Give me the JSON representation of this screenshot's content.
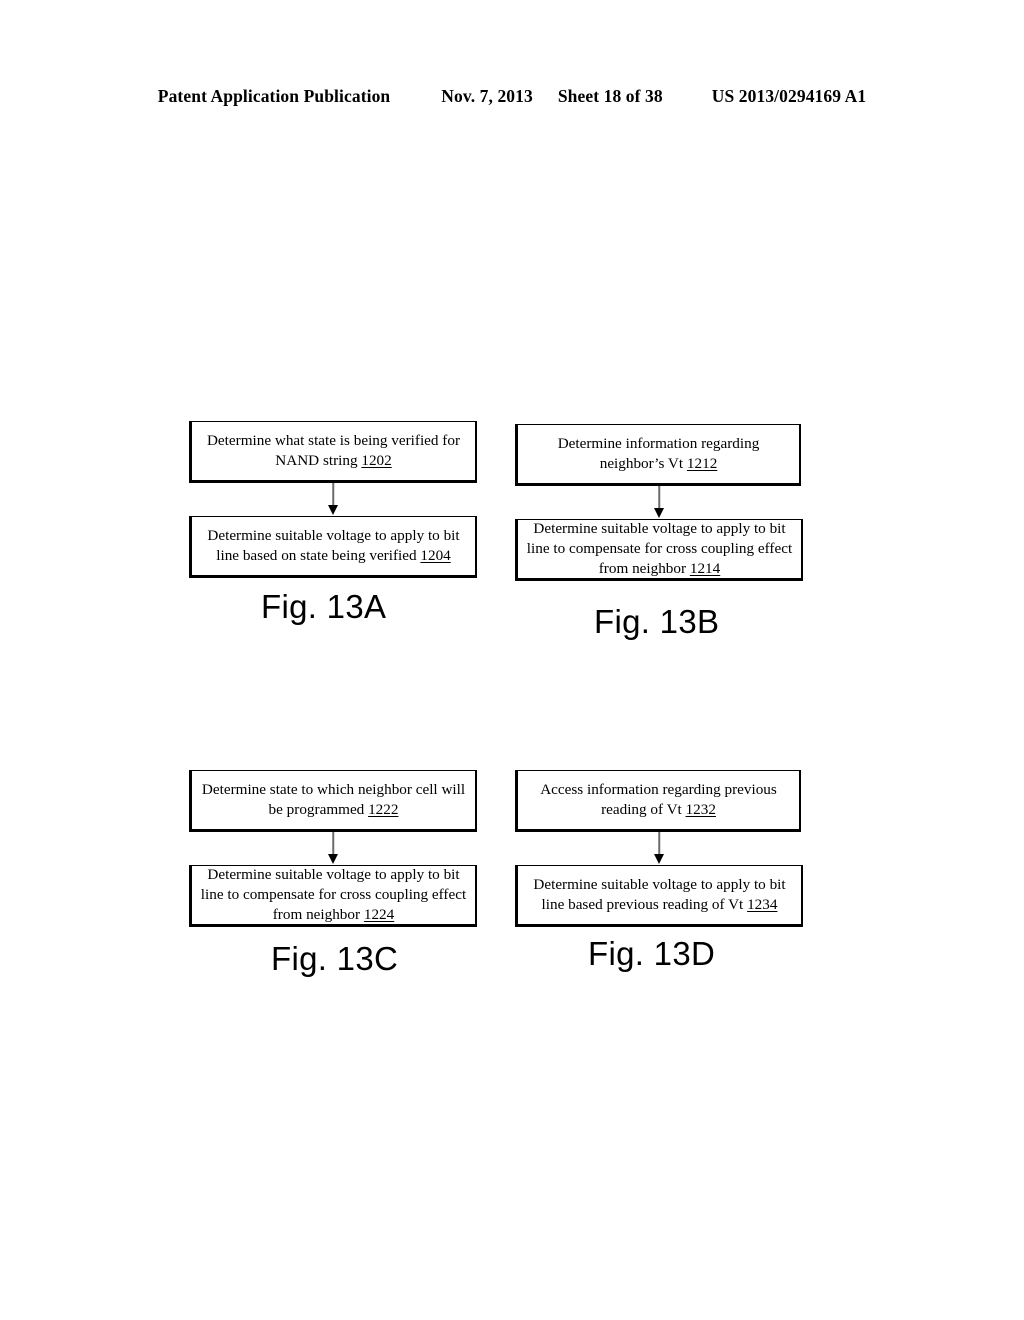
{
  "header": {
    "publication": "Patent Application Publication",
    "date": "Nov. 7, 2013",
    "sheet": "Sheet 18 of 38",
    "pub_number": "US 2013/0294169 A1"
  },
  "figures": [
    {
      "id": "13A",
      "caption": "Fig. 13A",
      "steps": [
        {
          "text_before": "Determine what state is being verified for NAND string ",
          "ref": "1202"
        },
        {
          "text_before": "Determine suitable voltage to apply to bit line based on state being verified ",
          "ref": "1204"
        }
      ]
    },
    {
      "id": "13B",
      "caption": "Fig. 13B",
      "steps": [
        {
          "text_before": "Determine information regarding neighbor’s Vt ",
          "ref": "1212"
        },
        {
          "text_before": "Determine suitable voltage to apply to bit line to compensate for cross coupling effect from neighbor ",
          "ref": "1214"
        }
      ]
    },
    {
      "id": "13C",
      "caption": "Fig. 13C",
      "steps": [
        {
          "text_before": "Determine state to which neighbor cell will be programmed ",
          "ref": "1222"
        },
        {
          "text_before": "Determine suitable voltage to apply to bit line to compensate for cross coupling effect from neighbor ",
          "ref": "1224"
        }
      ]
    },
    {
      "id": "13D",
      "caption": "Fig. 13D",
      "steps": [
        {
          "text_before": "Access information regarding previous reading of Vt ",
          "ref": "1232"
        },
        {
          "text_before": "Determine suitable voltage to apply to bit line based previous reading of Vt ",
          "ref": "1234"
        }
      ]
    }
  ],
  "colors": {
    "ink": "#000000",
    "paper": "#ffffff",
    "connector": "#6b6b6b"
  }
}
